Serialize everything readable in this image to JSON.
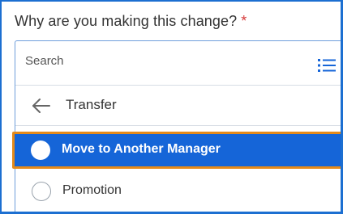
{
  "prompt": {
    "label": "Why are you making this change?",
    "required_marker": "*"
  },
  "search": {
    "placeholder": "Search",
    "list_icon": "list-icon"
  },
  "navigation": {
    "back_icon": "arrow-left-icon",
    "category": "Transfer"
  },
  "options": [
    {
      "label": "Move to Another Manager",
      "selected": true
    },
    {
      "label": "Promotion",
      "selected": false
    }
  ],
  "colors": {
    "selected_background": "#1565d8",
    "focus_outline": "#e58a1a",
    "required": "#d63b3b",
    "icon_accent": "#1565d8",
    "frame_border": "#1c6fd1"
  }
}
